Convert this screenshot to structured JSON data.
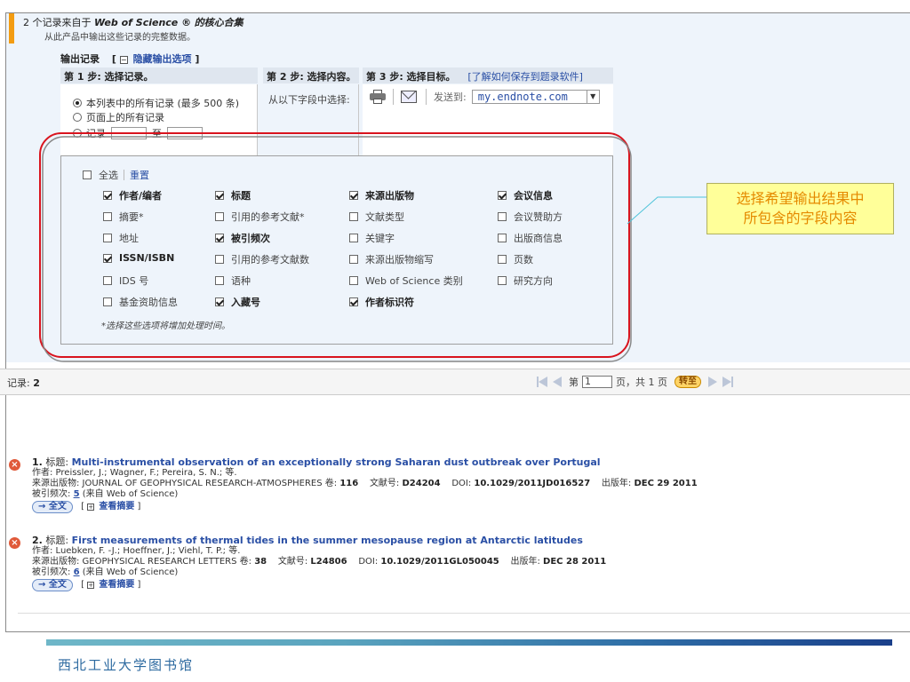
{
  "header": {
    "records_from": "2 个记录来自于",
    "brand": "Web of Science ®",
    "collection": "的核心合集",
    "note": "从此产品中输出这些记录的完整数据。"
  },
  "output": {
    "title": "输出记录",
    "hide_options": "隐藏输出选项",
    "bracket_open": "[",
    "bracket_close": "]",
    "minus_glyph": "−",
    "step1_header": "第 1 步: 选择记录。",
    "step2_header": "第 2 步: 选择内容。",
    "step3_header": "第 3 步: 选择目标。",
    "learn_link": "[了解如何保存到题录软件]",
    "radio_all": "本列表中的所有记录 (最多 500 条)",
    "radio_page": "页面上的所有记录",
    "radio_range": "记录",
    "range_to": "至",
    "from_fields": "从以下字段中选择:",
    "send_to": "发送到:",
    "send_to_value": "my.endnote.com",
    "select_all": "全选",
    "reset": "重置",
    "fields_note": "*选择这些选项将增加处理时间。",
    "fields": [
      {
        "label": "作者/编者",
        "checked": true
      },
      {
        "label": "标题",
        "checked": true
      },
      {
        "label": "来源出版物",
        "checked": true
      },
      {
        "label": "会议信息",
        "checked": true
      },
      {
        "label": "摘要*",
        "checked": false
      },
      {
        "label": "引用的参考文献*",
        "checked": false
      },
      {
        "label": "文献类型",
        "checked": false
      },
      {
        "label": "会议赞助方",
        "checked": false
      },
      {
        "label": "地址",
        "checked": false
      },
      {
        "label": "被引频次",
        "checked": true
      },
      {
        "label": "关键字",
        "checked": false
      },
      {
        "label": "出版商信息",
        "checked": false
      },
      {
        "label": "ISSN/ISBN",
        "checked": true
      },
      {
        "label": "引用的参考文献数",
        "checked": false
      },
      {
        "label": "来源出版物缩写",
        "checked": false
      },
      {
        "label": "页数",
        "checked": false
      },
      {
        "label": "IDS 号",
        "checked": false
      },
      {
        "label": "语种",
        "checked": false
      },
      {
        "label": "Web of Science 类别",
        "checked": false
      },
      {
        "label": "研究方向",
        "checked": false
      },
      {
        "label": "基金资助信息",
        "checked": false
      },
      {
        "label": "入藏号",
        "checked": true
      },
      {
        "label": "作者标识符",
        "checked": true
      }
    ]
  },
  "callout": {
    "line1": "选择希望输出结果中",
    "line2": "所包含的字段内容"
  },
  "records_bar": {
    "label": "记录:",
    "count": "2",
    "page_prefix": "第",
    "page_value": "1",
    "page_suffix": "页，共 1 页",
    "go": "转至"
  },
  "results": [
    {
      "num": "1.",
      "title_label": "标题:",
      "title": "Multi-instrumental observation of an exceptionally strong Saharan dust outbreak over Portugal",
      "authors": "作者: Preissler, J.; Wagner, F.; Pereira, S. N.; 等.",
      "source_label": "来源出版物: JOURNAL OF GEOPHYSICAL RESEARCH-ATMOSPHERES",
      "vol_label": "卷:",
      "vol": "116",
      "art_label": "文献号:",
      "art": "D24204",
      "doi_label": "DOI:",
      "doi": "10.1029/2011JD016527",
      "date_label": "出版年:",
      "date": "DEC 29 2011",
      "cites_label": "被引频次:",
      "cites": "5",
      "cites_from": "(来自 Web of Science)",
      "fulltext": "→ 全文",
      "abstract": "查看摘要"
    },
    {
      "num": "2.",
      "title_label": "标题:",
      "title": "First measurements of thermal tides in the summer mesopause region at Antarctic latitudes",
      "authors": "作者: Luebken, F. -J.; Hoeffner, J.; Viehl, T. P.; 等.",
      "source_label": "来源出版物: GEOPHYSICAL RESEARCH LETTERS",
      "vol_label": "卷:",
      "vol": "38",
      "art_label": "文献号:",
      "art": "L24806",
      "doi_label": "DOI:",
      "doi": "10.1029/2011GL050045",
      "date_label": "出版年:",
      "date": "DEC 28 2011",
      "cites_label": "被引频次:",
      "cites": "6",
      "cites_from": "(来自 Web of Science)",
      "fulltext": "→ 全文",
      "abstract": "查看摘要"
    }
  ],
  "footer": {
    "library": "西北工业大学图书馆"
  },
  "colors": {
    "accent_orange": "#f39c12",
    "highlight_red": "#d9141e",
    "link_blue": "#2a4fa5",
    "callout_text": "#e58a00",
    "callout_bg": "#ffff99"
  }
}
